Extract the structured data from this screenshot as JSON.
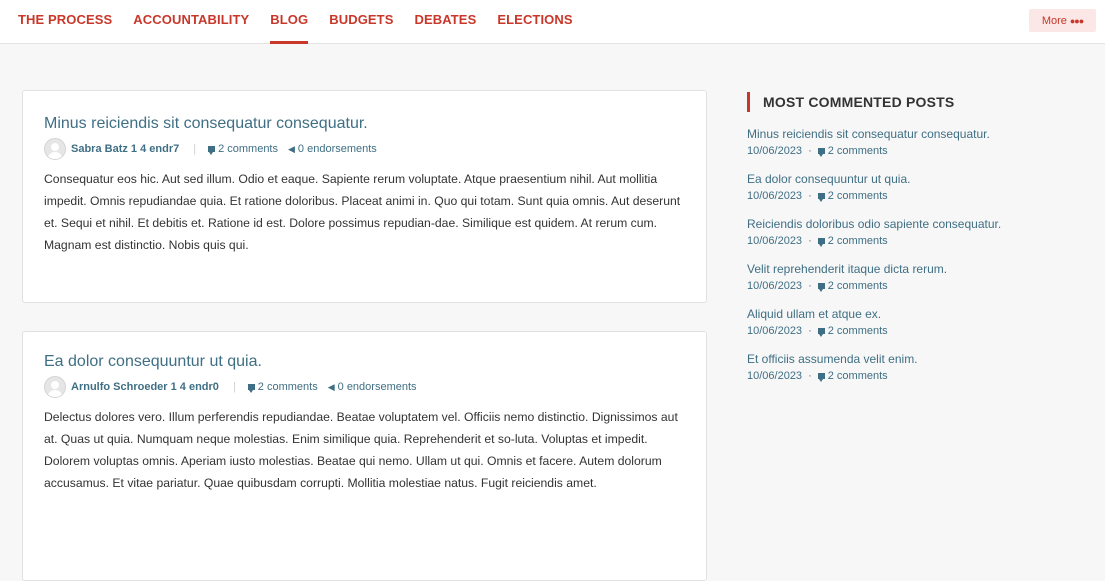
{
  "nav": {
    "items": [
      {
        "label": "THE PROCESS"
      },
      {
        "label": "ACCOUNTABILITY"
      },
      {
        "label": "BLOG"
      },
      {
        "label": "BUDGETS"
      },
      {
        "label": "DEBATES"
      },
      {
        "label": "ELECTIONS"
      }
    ],
    "active": "BLOG",
    "more_label": "More"
  },
  "posts": [
    {
      "title": "Minus reiciendis sit consequatur consequatur.",
      "author": "Sabra Batz 1 4 endr7",
      "comments": "2 comments",
      "endorsements": "0 endorsements",
      "body": "Consequatur eos hic. Aut sed illum. Odio et eaque. Sapiente rerum voluptate. Atque praesentium nihil. Aut mollitia impedit. Omnis repudiandae quia. Et ratione doloribus. Placeat animi in. Quo qui totam. Sunt quia omnis. Aut deserunt et. Sequi et nihil. Et debitis et. Ratione id est. Dolore possimus repudian-dae. Similique est quidem. At rerum cum. Magnam est distinctio. Nobis quis qui."
    },
    {
      "title": "Ea dolor consequuntur ut quia.",
      "author": "Arnulfo Schroeder 1 4 endr0",
      "comments": "2 comments",
      "endorsements": "0 endorsements",
      "body": "Delectus dolores vero. Illum perferendis repudiandae. Beatae voluptatem vel. Officiis nemo distinctio. Dignissimos aut at. Quas ut quia. Numquam neque molestias. Enim similique quia. Reprehenderit et so-luta. Voluptas et impedit. Dolorem voluptas omnis. Aperiam iusto molestias. Beatae qui nemo. Ullam ut qui. Omnis et facere. Autem dolorum accusamus. Et vitae pariatur. Quae quibusdam corrupti. Mollitia molestiae natus. Fugit reiciendis amet."
    }
  ],
  "sidebar": {
    "title": "MOST COMMENTED POSTS",
    "items": [
      {
        "title": "Minus reiciendis sit consequatur consequatur.",
        "date": "10/06/2023",
        "comments": "2 comments"
      },
      {
        "title": "Ea dolor consequuntur ut quia.",
        "date": "10/06/2023",
        "comments": "2 comments"
      },
      {
        "title": "Reiciendis doloribus odio sapiente consequatur.",
        "date": "10/06/2023",
        "comments": "2 comments"
      },
      {
        "title": "Velit reprehenderit itaque dicta rerum.",
        "date": "10/06/2023",
        "comments": "2 comments"
      },
      {
        "title": "Aliquid ullam et atque ex.",
        "date": "10/06/2023",
        "comments": "2 comments"
      },
      {
        "title": "Et officiis assumenda velit enim.",
        "date": "10/06/2023",
        "comments": "2 comments"
      }
    ]
  },
  "colors": {
    "accent": "#c9372a",
    "link": "#3f6f84",
    "background": "#f7f7f7"
  }
}
